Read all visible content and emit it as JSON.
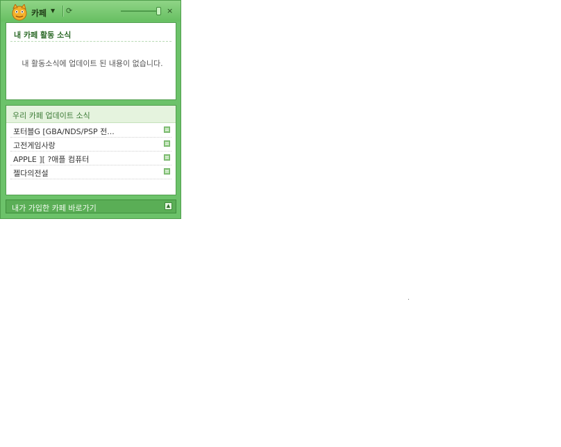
{
  "app": {
    "title": "카페",
    "dropdown_icon": "chevron-down-icon",
    "refresh_icon": "refresh-icon",
    "close_icon": "close-icon",
    "close_glyph": "×",
    "dropdown_glyph": "▼",
    "refresh_glyph": "⟳",
    "volume_level": 0.9
  },
  "activity": {
    "title": "내 카페 활동 소식",
    "empty_message": "내 활동소식에 업데이트 된 내용이 없습니다."
  },
  "updates": {
    "title": "우리 카페 업데이트 소식",
    "items": [
      {
        "label": "포터블G [GBA/NDS/PSP 전..."
      },
      {
        "label": "고전게임사랑"
      },
      {
        "label": "APPLE ][ ?애플 컴퓨터"
      },
      {
        "label": "젤다의전설"
      }
    ]
  },
  "footer": {
    "label": "내가 가입한 카페 바로가기",
    "toggle_glyph": "▲"
  },
  "colors": {
    "accent": "#6cc26a",
    "border": "#4f9e4c",
    "heading": "#2e6b2a"
  }
}
